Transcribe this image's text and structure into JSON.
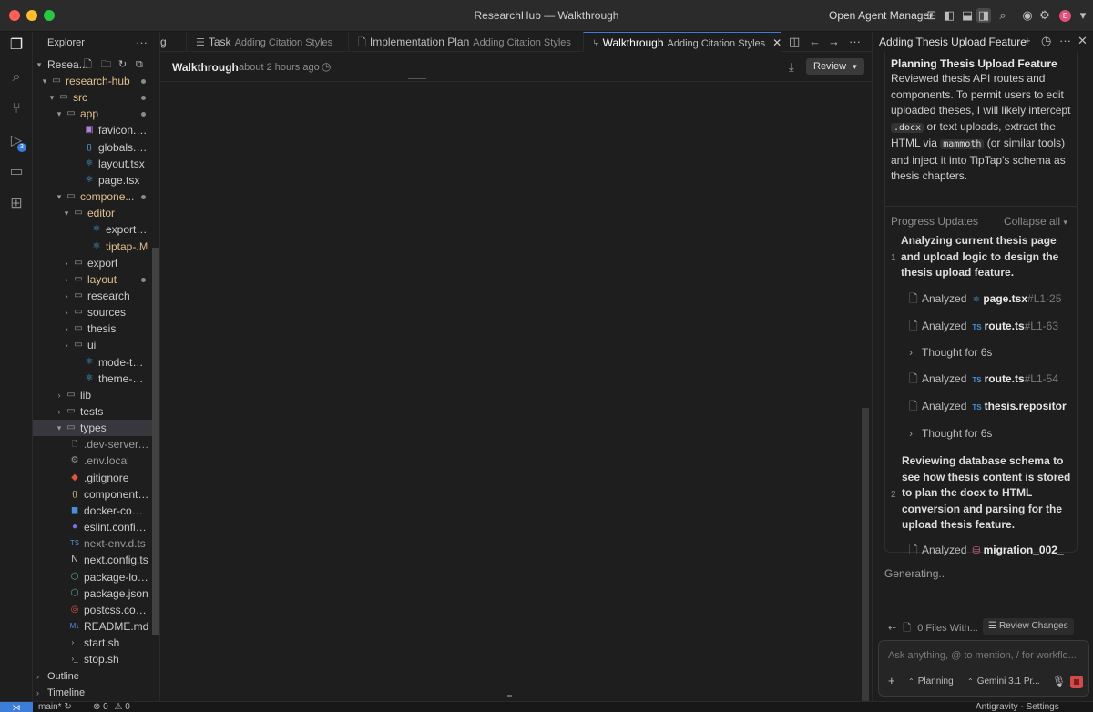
{
  "window": {
    "title": "ResearchHub — Walkthrough",
    "agent_manager": "Open Agent Manager",
    "avatar_initial": "E"
  },
  "activity": {
    "source_control_badge": "3"
  },
  "explorer": {
    "title": "Explorer",
    "root": "Resea...",
    "tree": [
      {
        "label": "research-hub",
        "type": "folder-open",
        "depth": 1,
        "color": "#e2c08d",
        "dot": true
      },
      {
        "label": "src",
        "type": "folder-open",
        "depth": 2,
        "color": "#e2c08d",
        "dot": true
      },
      {
        "label": "app",
        "type": "folder-open",
        "depth": 3,
        "color": "#e2c08d",
        "dot": true
      },
      {
        "label": "favicon.ico",
        "type": "image",
        "depth": 4
      },
      {
        "label": "globals.css",
        "type": "css",
        "depth": 4
      },
      {
        "label": "layout.tsx",
        "type": "react",
        "depth": 4
      },
      {
        "label": "page.tsx",
        "type": "react",
        "depth": 4
      },
      {
        "label": "compone...",
        "type": "folder-open",
        "depth": 3,
        "color": "#e2c08d",
        "dot": true
      },
      {
        "label": "editor",
        "type": "folder-open",
        "depth": 4,
        "color": "#e2c08d"
      },
      {
        "label": "export-butt...",
        "type": "react",
        "depth": 5
      },
      {
        "label": "tiptap-...",
        "type": "react",
        "depth": 5,
        "color": "#e2c08d",
        "mark": "M"
      },
      {
        "label": "export",
        "type": "folder",
        "depth": 4
      },
      {
        "label": "layout",
        "type": "folder",
        "depth": 4,
        "color": "#e2c08d",
        "dot": true
      },
      {
        "label": "research",
        "type": "folder",
        "depth": 4
      },
      {
        "label": "sources",
        "type": "folder",
        "depth": 4
      },
      {
        "label": "thesis",
        "type": "folder",
        "depth": 4
      },
      {
        "label": "ui",
        "type": "folder",
        "depth": 4
      },
      {
        "label": "mode-toggle....",
        "type": "react",
        "depth": 4
      },
      {
        "label": "theme-provid...",
        "type": "react",
        "depth": 4
      },
      {
        "label": "lib",
        "type": "folder",
        "depth": 3
      },
      {
        "label": "tests",
        "type": "folder",
        "depth": 3
      },
      {
        "label": "types",
        "type": "folder-open",
        "depth": 3,
        "selected": true
      },
      {
        "label": ".dev-server.pid",
        "type": "file",
        "depth": 2,
        "color": "#9a9a9a"
      },
      {
        "label": ".env.local",
        "type": "gear",
        "depth": 2,
        "color": "#9a9a9a"
      },
      {
        "label": ".gitignore",
        "type": "git",
        "depth": 2
      },
      {
        "label": "components.json",
        "type": "json",
        "depth": 2
      },
      {
        "label": "docker-compos...",
        "type": "docker",
        "depth": 2
      },
      {
        "label": "eslint.config.mjs",
        "type": "eslint",
        "depth": 2
      },
      {
        "label": "next-env.d.ts",
        "type": "ts",
        "depth": 2,
        "color": "#9a9a9a"
      },
      {
        "label": "next.config.ts",
        "type": "next",
        "depth": 2
      },
      {
        "label": "package-lock.js...",
        "type": "npm",
        "depth": 2
      },
      {
        "label": "package.json",
        "type": "npm",
        "depth": 2
      },
      {
        "label": "postcss.config....",
        "type": "postcss",
        "depth": 2
      },
      {
        "label": "README.md",
        "type": "md",
        "depth": 2
      },
      {
        "label": "start.sh",
        "type": "sh",
        "depth": 2
      },
      {
        "label": "stop.sh",
        "type": "sh",
        "depth": 2
      }
    ],
    "outline": "Outline",
    "timeline": "Timeline"
  },
  "tabs": [
    {
      "label": "g",
      "sub": ""
    },
    {
      "label": "Task",
      "sub": "Adding Citation Styles"
    },
    {
      "label": "Implementation Plan",
      "sub": "Adding Citation Styles"
    },
    {
      "label": "Walkthrough",
      "sub": "Adding Citation Styles",
      "active": true
    }
  ],
  "walkthrough": {
    "title": "Walkthrough",
    "time": "about 2 hours ago",
    "review": "Review"
  },
  "panel": {
    "title": "Adding Thesis Upload Feature",
    "planning_title": "Planning Thesis Upload Feature",
    "planning_text_1": "Reviewed thesis API routes and components. To permit users to edit uploaded theses, I will likely intercept",
    "code_1": ".docx",
    "planning_text_2": "or text uploads, extract the HTML via",
    "code_2": "mammoth",
    "planning_text_3": "(or similar tools) and inject it into TipTap's schema as thesis chapters.",
    "progress_label": "Progress Updates",
    "collapse_label": "Collapse all",
    "step1_num": "1",
    "step1_text": "Analyzing current thesis page and upload logic to design the thesis upload feature.",
    "step1_items": [
      {
        "kind": "analyzed",
        "verb": "Analyzed",
        "icon": "react",
        "file": "page.tsx",
        "range": "#L1-25"
      },
      {
        "kind": "analyzed",
        "verb": "Analyzed",
        "icon": "ts",
        "file": "route.ts",
        "range": "#L1-63"
      },
      {
        "kind": "thought",
        "verb": "Thought for 6s"
      },
      {
        "kind": "analyzed",
        "verb": "Analyzed",
        "icon": "ts",
        "file": "route.ts",
        "range": "#L1-54"
      },
      {
        "kind": "analyzed",
        "verb": "Analyzed",
        "icon": "ts",
        "file": "thesis.repositor",
        "range": ""
      },
      {
        "kind": "thought",
        "verb": "Thought for 6s"
      }
    ],
    "step2_num": "2",
    "step2_text": "Reviewing database schema to see how thesis content is stored to plan the docx to HTML conversion and parsing for the upload thesis feature.",
    "step2_item": {
      "verb": "Analyzed",
      "file": "migration_002_"
    },
    "generating": "Generating..",
    "files_with": "0 Files With...",
    "review_changes": "Review Changes",
    "chat_placeholder": "Ask anything, @ to mention, / for workflo...",
    "mode": "Planning",
    "model": "Gemini 3.1 Pr..."
  },
  "status": {
    "branch": "main*",
    "errors": "0",
    "warnings": "0",
    "right": "Antigravity - Settings"
  },
  "colors": {
    "accent": "#3b7dd8",
    "modified": "#e2c08d",
    "stop": "#d14b4b"
  }
}
